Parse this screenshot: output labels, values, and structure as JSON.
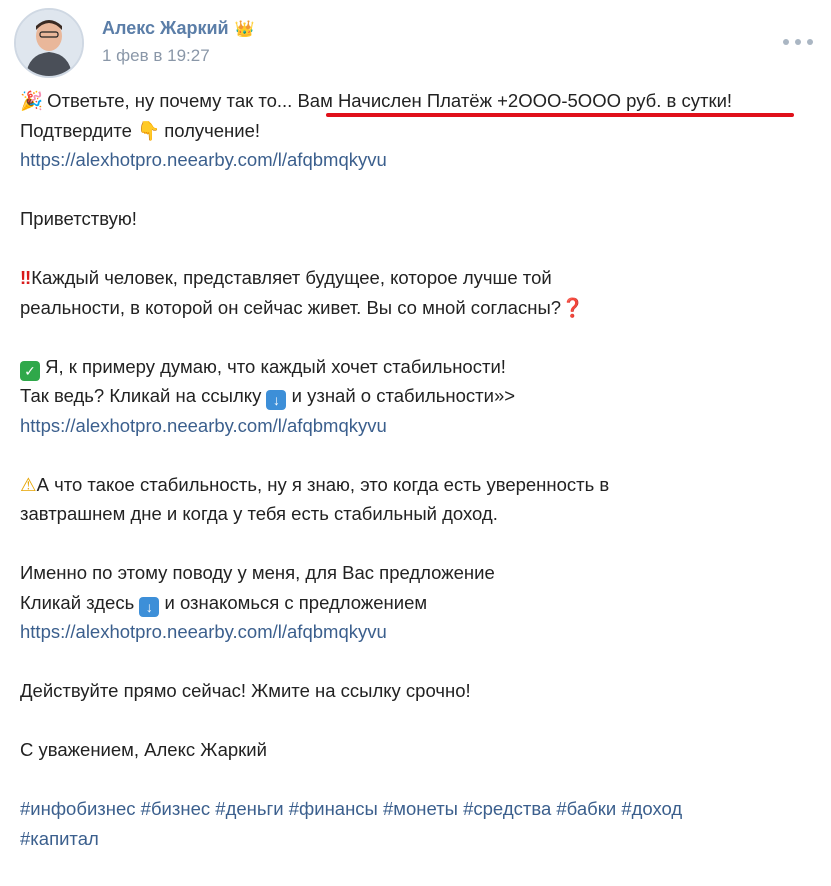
{
  "author": {
    "name": "Алекс Жаркий",
    "crown_icon": "crown-icon",
    "date": "1 фев в 19:27"
  },
  "colors": {
    "author_name": "#5b7ea8",
    "link": "#3b5f8d",
    "underline": "#e0101a",
    "meta": "#8a97a8"
  },
  "body": {
    "line1_prefix": "Ответьте, ну почему так то...",
    "line1_highlight": "Вам Начислен Платёж +2OOO-5OOO руб. в сутки!",
    "line2_a": "Подтвердите",
    "line2_b": "получение!",
    "link": "https://alexhotpro.neearby.com/l/afqbmqkyvu",
    "greeting": "Приветствую!",
    "para1_l1": "Каждый человек, представляет будущее, которое лучше той",
    "para1_l2": "реальности, в которой он сейчас живет. Вы со мной согласны?",
    "para2_l1": "Я, к примеру думаю, что каждый хочет стабильности!",
    "para2_l2a": "Так ведь? Кликай на ссылку",
    "para2_l2b": "и узнай о стабильности»>",
    "para3_l1": "А что такое стабильность, ну я знаю, это когда есть уверенность в",
    "para3_l2": "завтрашнем дне и когда у тебя есть стабильный доход.",
    "para4_l1": "Именно по этому поводу у меня, для Вас предложение",
    "para4_l2a": "Кликай здесь",
    "para4_l2b": "и ознакомься с предложением",
    "cta": "Действуйте прямо сейчас! Жмите на ссылку срочно!",
    "signature": "С уважением, Алекс Жаркий"
  },
  "hashtags": [
    "#инфобизнес",
    "#бизнес",
    "#деньги",
    "#финансы",
    "#монеты",
    "#средства",
    "#бабки",
    "#доход",
    "#капитал"
  ]
}
